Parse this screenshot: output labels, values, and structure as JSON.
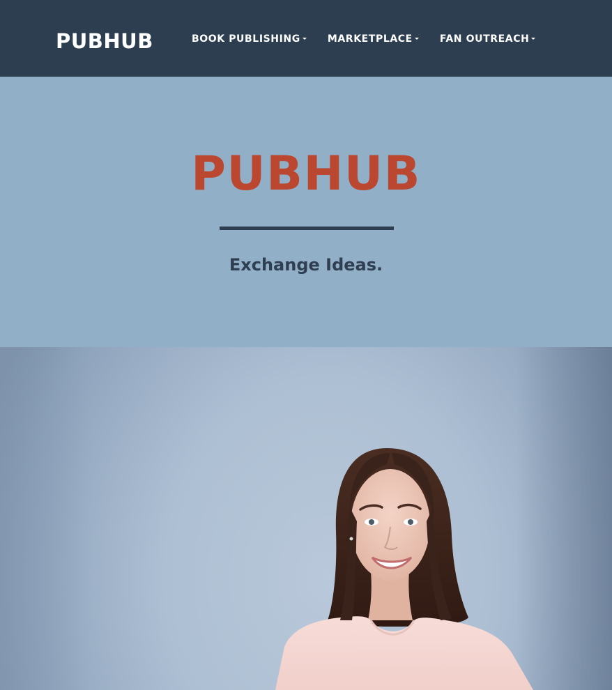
{
  "navbar": {
    "brand": "PUBHUB",
    "items": [
      {
        "label": "BOOK PUBLISHING"
      },
      {
        "label": "MARKETPLACE"
      },
      {
        "label": "FAN OUTREACH"
      }
    ]
  },
  "hero": {
    "title": "PUBHUB",
    "tagline": "Exchange Ideas."
  },
  "colors": {
    "navbar_bg": "#2c3e50",
    "hero_bg": "#91afc6",
    "title_accent": "#bb4730",
    "text_dark": "#2f3e50"
  }
}
